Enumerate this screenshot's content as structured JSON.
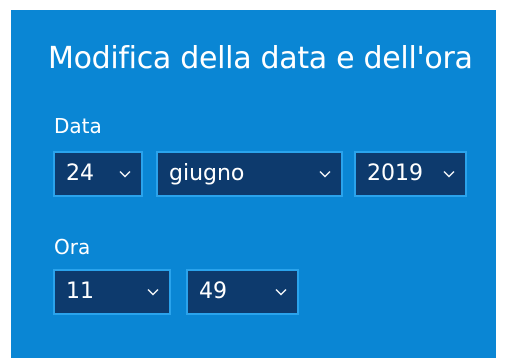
{
  "dialog": {
    "title": "Modifica della data e dell'ora",
    "background": "#0a86d4"
  },
  "date": {
    "label": "Data",
    "day": "24",
    "month": "giugno",
    "year": "2019"
  },
  "time": {
    "label": "Ora",
    "hour": "11",
    "minute": "49"
  },
  "icons": {
    "dropdown": "chevron-down-icon"
  }
}
